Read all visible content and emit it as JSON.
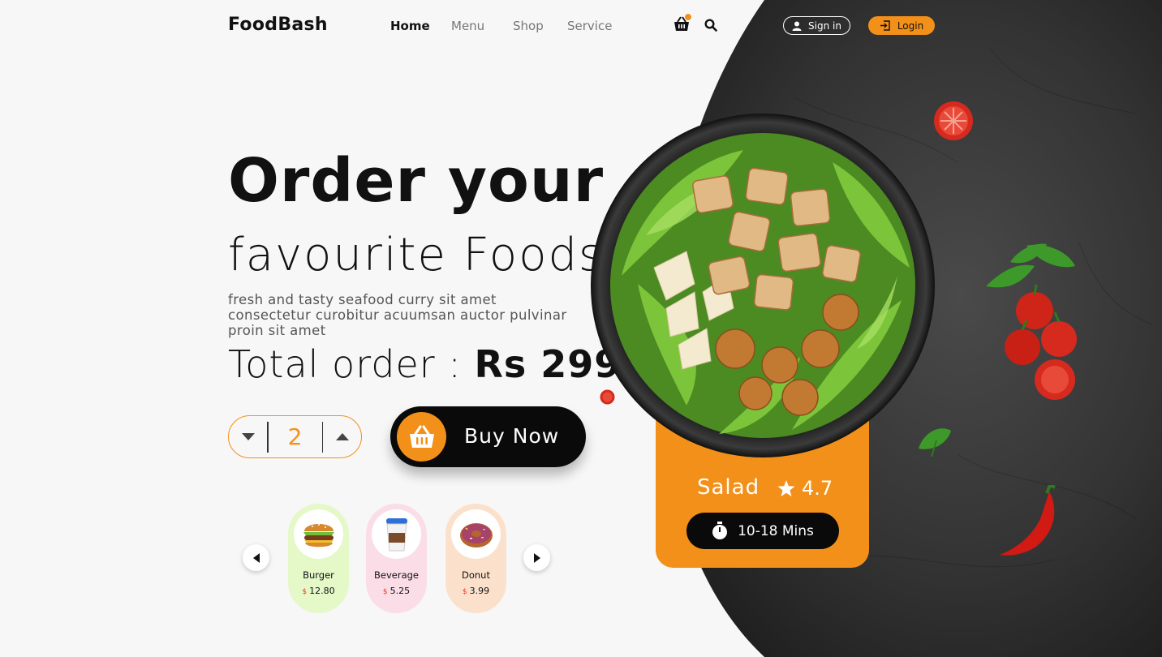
{
  "brand": {
    "name": "FoodBash"
  },
  "nav": {
    "items": [
      {
        "label": "Home",
        "active": true
      },
      {
        "label": "Menu",
        "active": false
      },
      {
        "label": "Shop",
        "active": false
      },
      {
        "label": "Service",
        "active": false
      }
    ],
    "cart_badge_color": "#f39019"
  },
  "auth": {
    "signin_label": "Sign in",
    "login_label": "Login"
  },
  "hero": {
    "title": "Order your",
    "subtitle": "favourite Foods",
    "description": "fresh and tasty seafood curry sit amet consectetur curobitur acuumsan auctor pulvinar proin sit amet",
    "total_label": "Total order : ",
    "total_price": "Rs 299"
  },
  "order": {
    "quantity": "2",
    "buy_label": "Buy Now"
  },
  "carousel": {
    "items": [
      {
        "name": "Burger",
        "currency": "$",
        "price": "12.80",
        "icon": "burger-icon"
      },
      {
        "name": "Beverage",
        "currency": "$",
        "price": "5.25",
        "icon": "coffee-cup-icon"
      },
      {
        "name": "Donut",
        "currency": "$",
        "price": "3.99",
        "icon": "donut-icon"
      }
    ]
  },
  "featured": {
    "name": "Salad",
    "rating": "4.7",
    "time": "10-18 Mins"
  },
  "colors": {
    "accent": "#f39019",
    "dark": "#0a0a0a",
    "background": "#f7f7f7"
  }
}
